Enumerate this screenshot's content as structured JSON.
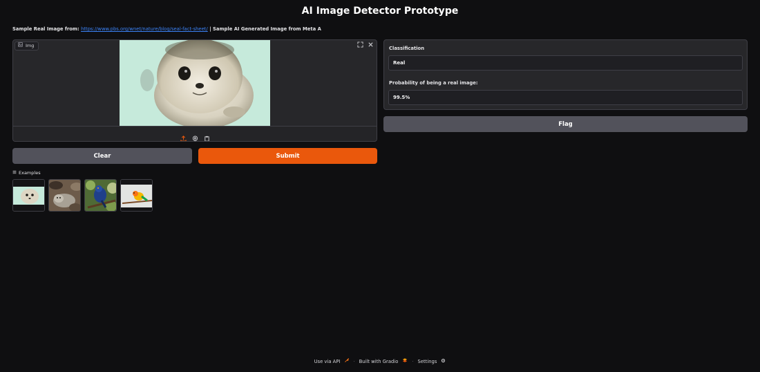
{
  "app": {
    "title": "AI Image Detector Prototype"
  },
  "sources": {
    "real_prefix": "Sample Real Image from:",
    "real_link": "https://www.pbs.org/wnet/nature/blog/seal-fact-sheet/",
    "ai_text": "| Sample AI Generated Image from Meta A"
  },
  "image_input": {
    "label": "Img",
    "icons": [
      "image-icon",
      "fullscreen-icon",
      "close-icon",
      "upload-icon",
      "webcam-icon",
      "clipboard-icon"
    ]
  },
  "buttons": {
    "clear": "Clear",
    "submit": "Submit",
    "flag": "Flag"
  },
  "examples": {
    "label": "Examples",
    "items": [
      "seal-closeup",
      "seals-on-rocks",
      "blue-bird-on-branch",
      "parrot-on-branch"
    ]
  },
  "output": {
    "classification_label": "Classification",
    "classification_value": "Real",
    "probability_label": "Probability of being a real image:",
    "probability_value": "99.5%"
  },
  "footer": {
    "api": "Use via API",
    "built": "Built with Gradio",
    "settings": "Settings"
  },
  "colors": {
    "background": "#0f0f11",
    "panel": "#27272a",
    "primary": "#ea580c",
    "secondary": "#52525b",
    "link": "#3b82f6"
  }
}
